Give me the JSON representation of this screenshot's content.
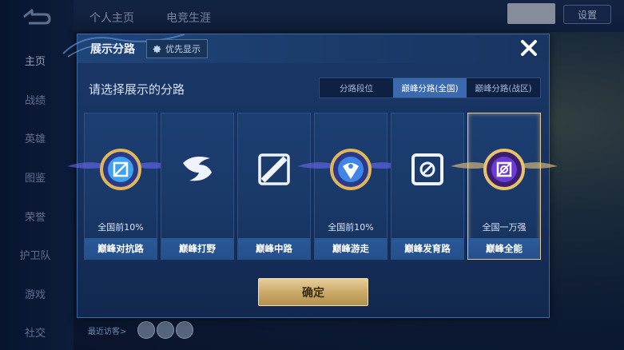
{
  "sidebar": {
    "items": [
      {
        "label": "主页"
      },
      {
        "label": "战绩"
      },
      {
        "label": "英雄"
      },
      {
        "label": "图鉴"
      },
      {
        "label": "荣誉"
      },
      {
        "label": "护卫队"
      },
      {
        "label": "游戏"
      },
      {
        "label": "社交"
      }
    ]
  },
  "topbar": {
    "tabs": [
      {
        "label": "个人主页"
      },
      {
        "label": "电竞生涯"
      }
    ],
    "settings_label": "设置"
  },
  "modal": {
    "title": "展示分路",
    "priority_label": "优先显示",
    "subtitle": "请选择展示的分路",
    "tabs": [
      {
        "label": "分路段位"
      },
      {
        "label": "巅峰分路(全国)"
      },
      {
        "label": "巅峰分路(战区)"
      }
    ],
    "active_tab": "巅峰分路(全国)",
    "cards": [
      {
        "name": "巅峰对抗路",
        "rank": "全国前10%",
        "emblem": "clash-lane-emblem",
        "selected": false
      },
      {
        "name": "巅峰打野",
        "rank": "",
        "emblem": "jungle-emblem",
        "selected": false
      },
      {
        "name": "巅峰中路",
        "rank": "",
        "emblem": "mid-lane-emblem",
        "selected": false
      },
      {
        "name": "巅峰游走",
        "rank": "全国前10%",
        "emblem": "roam-emblem",
        "selected": false
      },
      {
        "name": "巅峰发育路",
        "rank": "",
        "emblem": "farm-lane-emblem",
        "selected": false
      },
      {
        "name": "巅峰全能",
        "rank": "全国一万强",
        "emblem": "all-round-emblem",
        "selected": true
      }
    ],
    "confirm_label": "确定"
  },
  "footer": {
    "recent_visitors_label": "最近访客>"
  },
  "colors": {
    "accent_gold": "#e6c68b",
    "active_tab": "#3b69ad",
    "card_bg": "#1c3e71",
    "name_bar": "#2b5997"
  }
}
